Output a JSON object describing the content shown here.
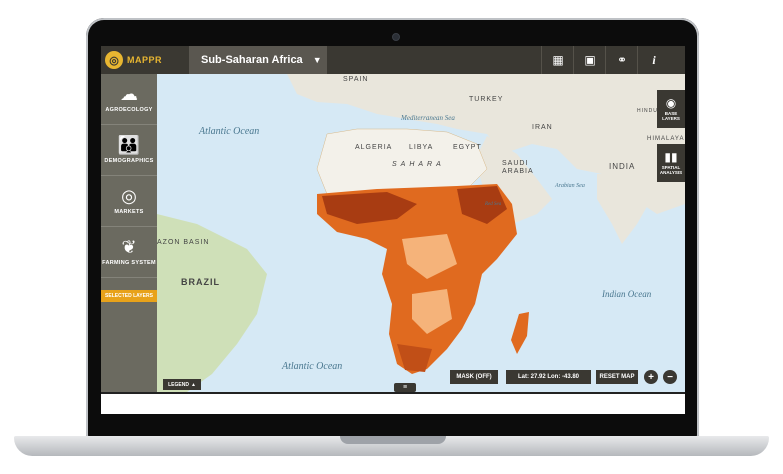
{
  "app": {
    "name": "MAPPR",
    "region": "Sub-Saharan Africa"
  },
  "toolbar": {
    "icons": [
      "table-icon",
      "image-icon",
      "link-icon",
      "info-icon"
    ],
    "info_glyph": "i"
  },
  "sidebar": {
    "items": [
      {
        "label": "AGROECOLOGY",
        "icon": "cloud-sun-icon"
      },
      {
        "label": "DEMOGRAPHICS",
        "icon": "people-icon"
      },
      {
        "label": "MARKETS",
        "icon": "target-icon"
      },
      {
        "label": "FARMING SYSTEM",
        "icon": "wheat-icon"
      }
    ],
    "selected_layers": "SELECTED LAYERS"
  },
  "map": {
    "oceans": [
      "Atlantic Ocean",
      "Atlantic Ocean",
      "Indian Ocean",
      "Arabian Sea"
    ],
    "seas": [
      "Mediterranean Sea",
      "Red Sea"
    ],
    "countries": [
      "SPAIN",
      "TURKEY",
      "ALGERIA",
      "LIBYA",
      "EGYPT",
      "SAUDI ARABIA",
      "IRAN",
      "INDIA",
      "BRAZIL",
      "SAHARA"
    ],
    "regions": [
      "AZON BASIN",
      "HIMALAYA",
      "HINDU KUSH"
    ]
  },
  "right_panel": {
    "base_layers": "BASE LAYERS",
    "spatial_analysis": "SPATIAL ANALYSIS"
  },
  "controls": {
    "legend": "LEGEND",
    "mask": "MASK (OFF)",
    "coords": "Lat: 27.92  Lon: -43.80",
    "reset": "RESET MAP",
    "zoom_in": "+",
    "zoom_out": "−"
  },
  "colors": {
    "accent": "#e8b631",
    "chrome": "#3a3832",
    "sidebar": "#6b6a60",
    "ocean": "#d6e9f5",
    "choropleth_dark": "#a83c12",
    "choropleth_mid": "#e06a1f",
    "choropleth_light": "#f5b37a"
  }
}
